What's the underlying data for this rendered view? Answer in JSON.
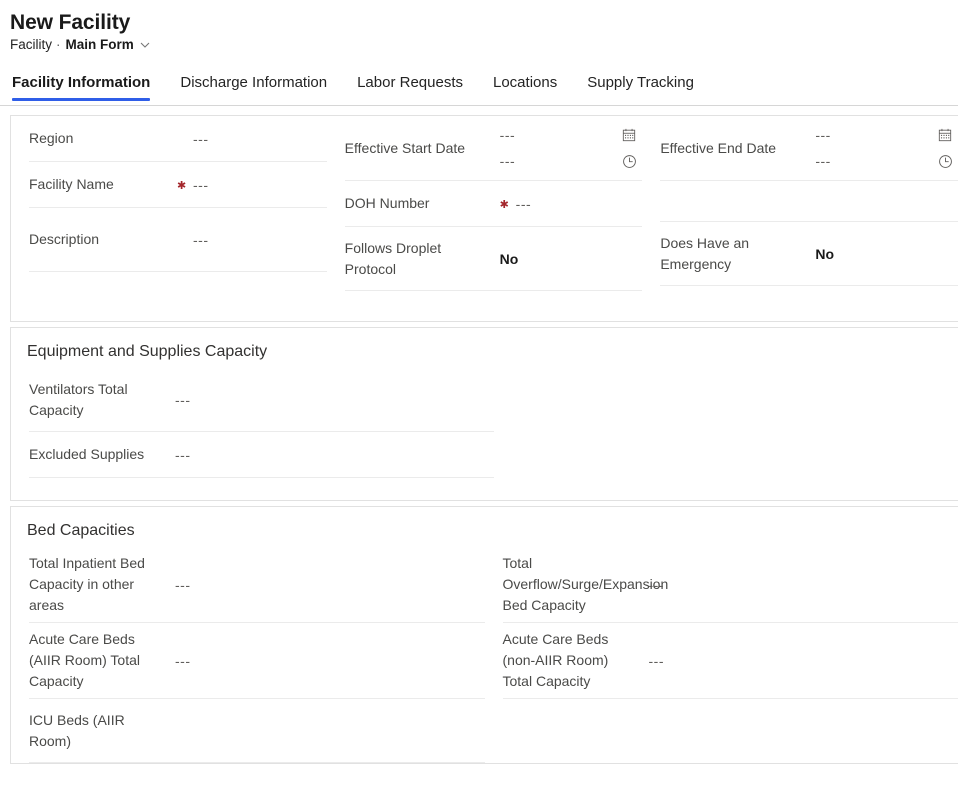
{
  "header": {
    "record_title": "New Facility",
    "entity_name": "Facility",
    "separator": "·",
    "form_name": "Main Form",
    "chevron_icon": "chevron-down-icon"
  },
  "theme": {
    "accent": "#2f5ee8",
    "required_star_color": "#a4262c",
    "label_color": "#4a4a48",
    "placeholder_color": "#605e5c"
  },
  "tabs": [
    {
      "label": "Facility Information",
      "selected": true
    },
    {
      "label": "Discharge Information",
      "selected": false
    },
    {
      "label": "Labor Requests",
      "selected": false
    },
    {
      "label": "Locations",
      "selected": false
    },
    {
      "label": "Supply Tracking",
      "selected": false
    }
  ],
  "placeholder": "---",
  "sections": [
    {
      "id": "facility-details",
      "title": "",
      "fields": {
        "region": {
          "label": "Region",
          "value": "---",
          "required": false
        },
        "facility_name": {
          "label": "Facility Name",
          "value": "---",
          "required": true
        },
        "description": {
          "label": "Description",
          "value": "---",
          "required": false
        },
        "effective_start_date": {
          "label": "Effective Start Date",
          "date_value": "---",
          "time_value": "---",
          "date_icon": "calendar-icon",
          "time_icon": "clock-icon",
          "required": false
        },
        "effective_end_date": {
          "label": "Effective End Date",
          "date_value": "---",
          "time_value": "---",
          "date_icon": "calendar-icon",
          "time_icon": "clock-icon",
          "required": false
        },
        "doh_number": {
          "label": "DOH Number",
          "value": "---",
          "required": true
        },
        "follows_droplet_protocol": {
          "label": "Follows Droplet Protocol",
          "value": "No",
          "required": false
        },
        "does_have_an_emergency": {
          "label": "Does Have an Emergency",
          "value": "No",
          "required": false
        }
      }
    },
    {
      "id": "equipment-supplies-capacity",
      "title": "Equipment and Supplies Capacity",
      "fields": {
        "ventilators_total_capacity": {
          "label": "Ventilators Total Capacity",
          "value": "---",
          "required": false
        },
        "excluded_supplies": {
          "label": "Excluded Supplies",
          "value": "---",
          "required": false
        }
      }
    },
    {
      "id": "bed-capacities",
      "title": "Bed Capacities",
      "fields": {
        "total_inpatient_other_areas": {
          "label": "Total Inpatient Bed Capacity in other areas",
          "value": "---",
          "required": false
        },
        "acute_care_aiir": {
          "label": "Acute Care Beds (AIIR Room) Total Capacity",
          "value": "---",
          "required": false
        },
        "icu_beds_aiir": {
          "label": "ICU Beds (AIIR Room)",
          "value": "",
          "required": false
        },
        "total_overflow_surge": {
          "label": "Total Overflow/Surge/Expansion Bed Capacity",
          "value": "---",
          "required": false
        },
        "acute_care_non_aiir": {
          "label": "Acute Care Beds (non-AIIR Room) Total Capacity",
          "value": "---",
          "required": false
        }
      }
    }
  ]
}
